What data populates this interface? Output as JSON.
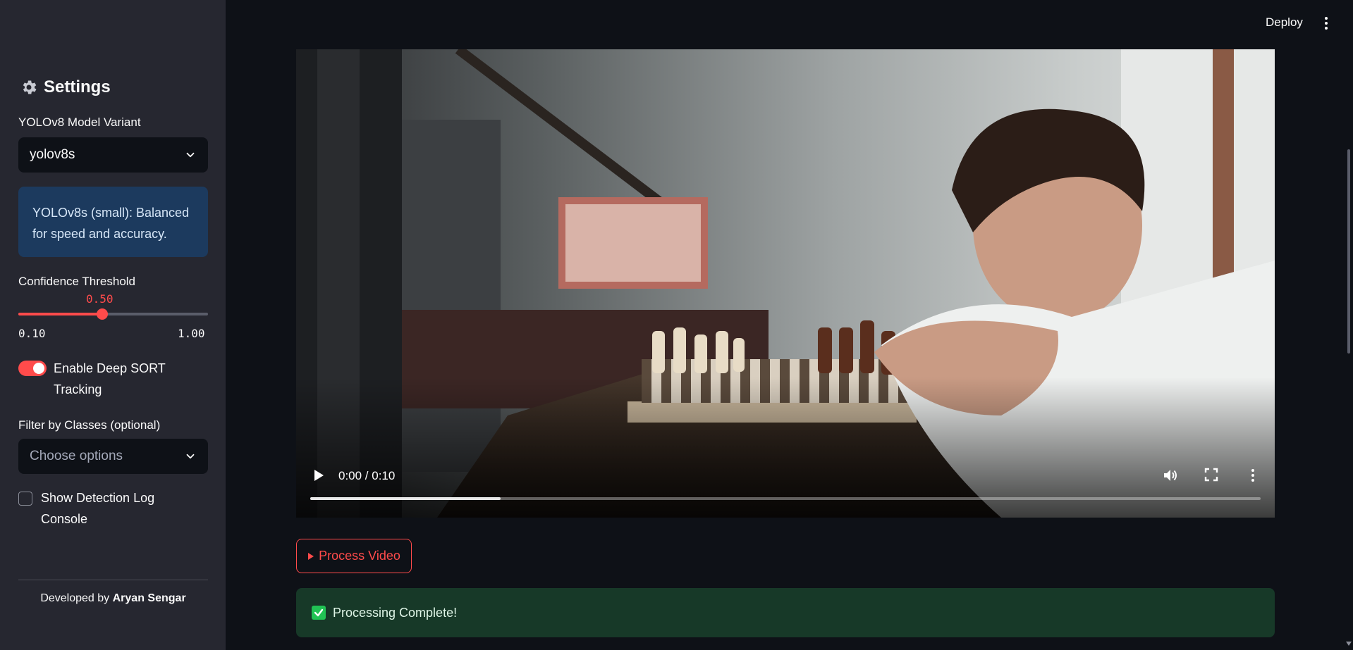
{
  "sidebar": {
    "title": "Settings",
    "title_icon": "gear-icon",
    "model": {
      "label": "YOLOv8 Model Variant",
      "selected": "yolov8s",
      "info": "YOLOv8s (small): Balanced for speed and accuracy."
    },
    "confidence": {
      "label": "Confidence Threshold",
      "value": "0.50",
      "min": "0.10",
      "max": "1.00",
      "fraction": 0.444
    },
    "tracking": {
      "label": "Enable Deep SORT Tracking",
      "enabled": true
    },
    "class_filter": {
      "label": "Filter by Classes (optional)",
      "placeholder": "Choose options"
    },
    "detection_log": {
      "label": "Show Detection Log Console",
      "checked": false
    },
    "footer": {
      "prefix": "Developed by",
      "author": "Aryan Sengar"
    }
  },
  "topbar": {
    "deploy_label": "Deploy",
    "menu_icon": "more-vertical-icon"
  },
  "video": {
    "time": "0:00 / 0:10",
    "progress_fraction": 0.2
  },
  "process_button": {
    "label": "Process Video",
    "icon": "play-triangle-icon"
  },
  "status": {
    "message": "Processing Complete!",
    "icon": "check-icon"
  },
  "colors": {
    "accent": "#ff4b4b",
    "background": "#0e1117",
    "sidebar": "#262730",
    "success_bg": "#173928",
    "info_bg": "#1c3a5e"
  }
}
